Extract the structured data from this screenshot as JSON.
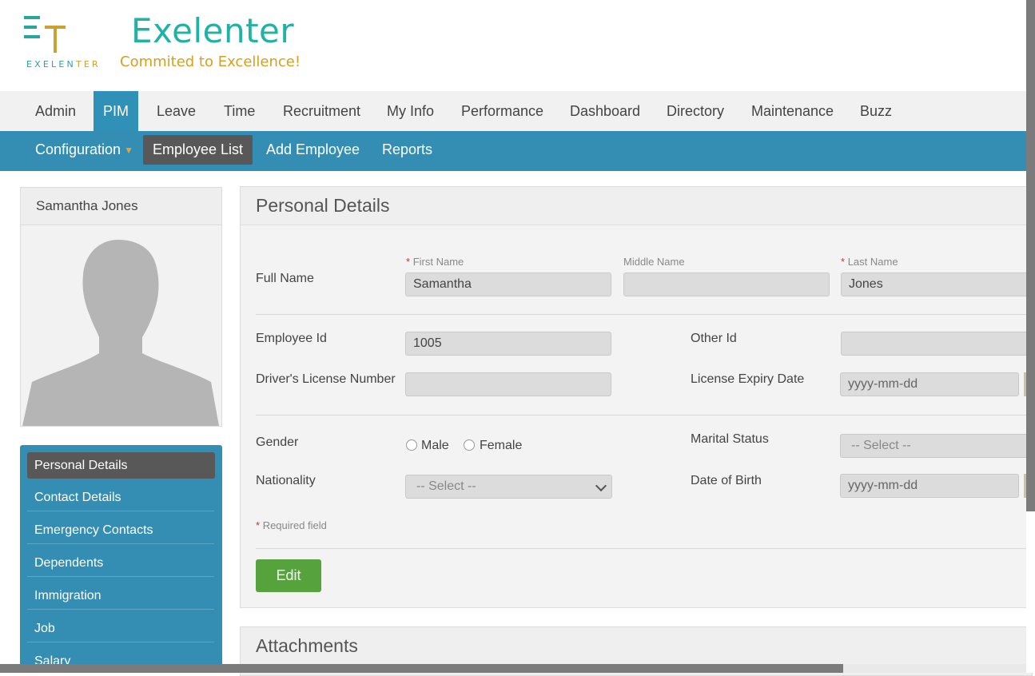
{
  "header": {
    "logo_word_main": "EXELEN",
    "logo_word_tail": "TER",
    "brand": "Exelenter",
    "tagline": "Commited to Excellence!"
  },
  "topmenu": {
    "items": [
      "Admin",
      "PIM",
      "Leave",
      "Time",
      "Recruitment",
      "My Info",
      "Performance",
      "Dashboard",
      "Directory",
      "Maintenance",
      "Buzz"
    ],
    "active": "PIM"
  },
  "submenu": {
    "configuration": "Configuration",
    "caret": "▼",
    "employee_list": "Employee List",
    "add_employee": "Add Employee",
    "reports": "Reports"
  },
  "profile": {
    "name": "Samantha Jones"
  },
  "sidenav": {
    "items": [
      "Personal Details",
      "Contact Details",
      "Emergency Contacts",
      "Dependents",
      "Immigration",
      "Job",
      "Salary"
    ],
    "active": "Personal Details"
  },
  "personal": {
    "title": "Personal Details",
    "full_name_label": "Full Name",
    "req_star": "*",
    "first_name_label": "First Name",
    "middle_name_label": "Middle Name",
    "last_name_label": "Last Name",
    "first_name": "Samantha",
    "middle_name": "",
    "last_name": "Jones",
    "employee_id_label": "Employee Id",
    "employee_id": "1005",
    "other_id_label": "Other Id",
    "other_id": "",
    "license_label": "Driver's License Number",
    "license": "",
    "license_expiry_label": "License Expiry Date",
    "license_expiry_placeholder": "yyyy-mm-dd",
    "gender_label": "Gender",
    "gender_male": "Male",
    "gender_female": "Female",
    "marital_label": "Marital Status",
    "marital_value": "-- Select --",
    "nationality_label": "Nationality",
    "nationality_value": "-- Select --",
    "dob_label": "Date of Birth",
    "dob_placeholder": "yyyy-mm-dd",
    "required_note": "Required field",
    "edit_button": "Edit"
  },
  "attachments": {
    "title": "Attachments"
  },
  "colors": {
    "menu_blue": "#348eb3",
    "active_dark": "#585858",
    "edit_green": "#56a23c",
    "brand_teal": "#21b2a6",
    "brand_gold": "#d4a020"
  }
}
